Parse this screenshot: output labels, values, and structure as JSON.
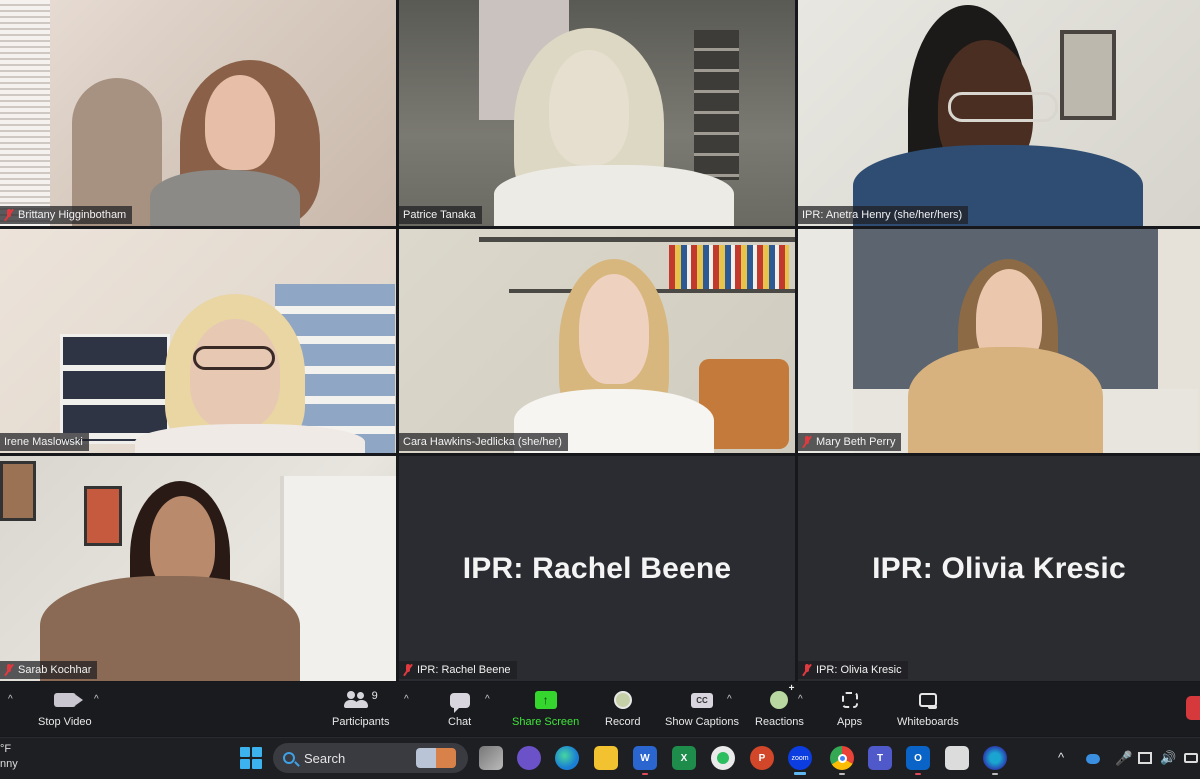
{
  "participants": [
    {
      "name": "Brittany Higginbotham",
      "muted": true,
      "video": true
    },
    {
      "name": "Patrice Tanaka",
      "muted": false,
      "video": true
    },
    {
      "name": "IPR: Anetra Henry (she/her/hers)",
      "muted": false,
      "video": true,
      "active_speaker": true
    },
    {
      "name": "Irene Maslowski",
      "muted": false,
      "video": true
    },
    {
      "name": "Cara Hawkins-Jedlicka (she/her)",
      "muted": false,
      "video": true
    },
    {
      "name": "Mary Beth Perry",
      "muted": true,
      "video": true
    },
    {
      "name": "Sarab Kochhar",
      "muted": true,
      "video": true
    },
    {
      "name": "IPR: Rachel Beene",
      "muted": true,
      "video": false,
      "display_name": "IPR: Rachel Beene"
    },
    {
      "name": "IPR: Olivia Kresic",
      "muted": true,
      "video": false,
      "display_name": "IPR: Olivia Kresic"
    }
  ],
  "toolbar": {
    "stop_video": "Stop Video",
    "participants": "Participants",
    "participants_count": "9",
    "chat": "Chat",
    "share_screen": "Share Screen",
    "record": "Record",
    "show_captions": "Show Captions",
    "captions_icon_text": "CC",
    "reactions": "Reactions",
    "apps": "Apps",
    "whiteboards": "Whiteboards",
    "share_color": "#35d62e",
    "leave_color": "#d6393c"
  },
  "taskbar": {
    "weather_line1": "°F",
    "weather_line2": "nny",
    "search_label": "Search",
    "apps": [
      {
        "name": "task-view",
        "label": ""
      },
      {
        "name": "teams-chat",
        "label": ""
      },
      {
        "name": "edge",
        "label": ""
      },
      {
        "name": "file-explorer",
        "label": ""
      },
      {
        "name": "word",
        "label": "W"
      },
      {
        "name": "excel",
        "label": "X"
      },
      {
        "name": "evernote",
        "label": ""
      },
      {
        "name": "powerpoint",
        "label": "P"
      },
      {
        "name": "zoom",
        "label": "zoom"
      },
      {
        "name": "chrome",
        "label": ""
      },
      {
        "name": "teams",
        "label": "T"
      },
      {
        "name": "outlook",
        "label": "O"
      },
      {
        "name": "snipping-tool",
        "label": ""
      },
      {
        "name": "webex",
        "label": ""
      }
    ]
  }
}
